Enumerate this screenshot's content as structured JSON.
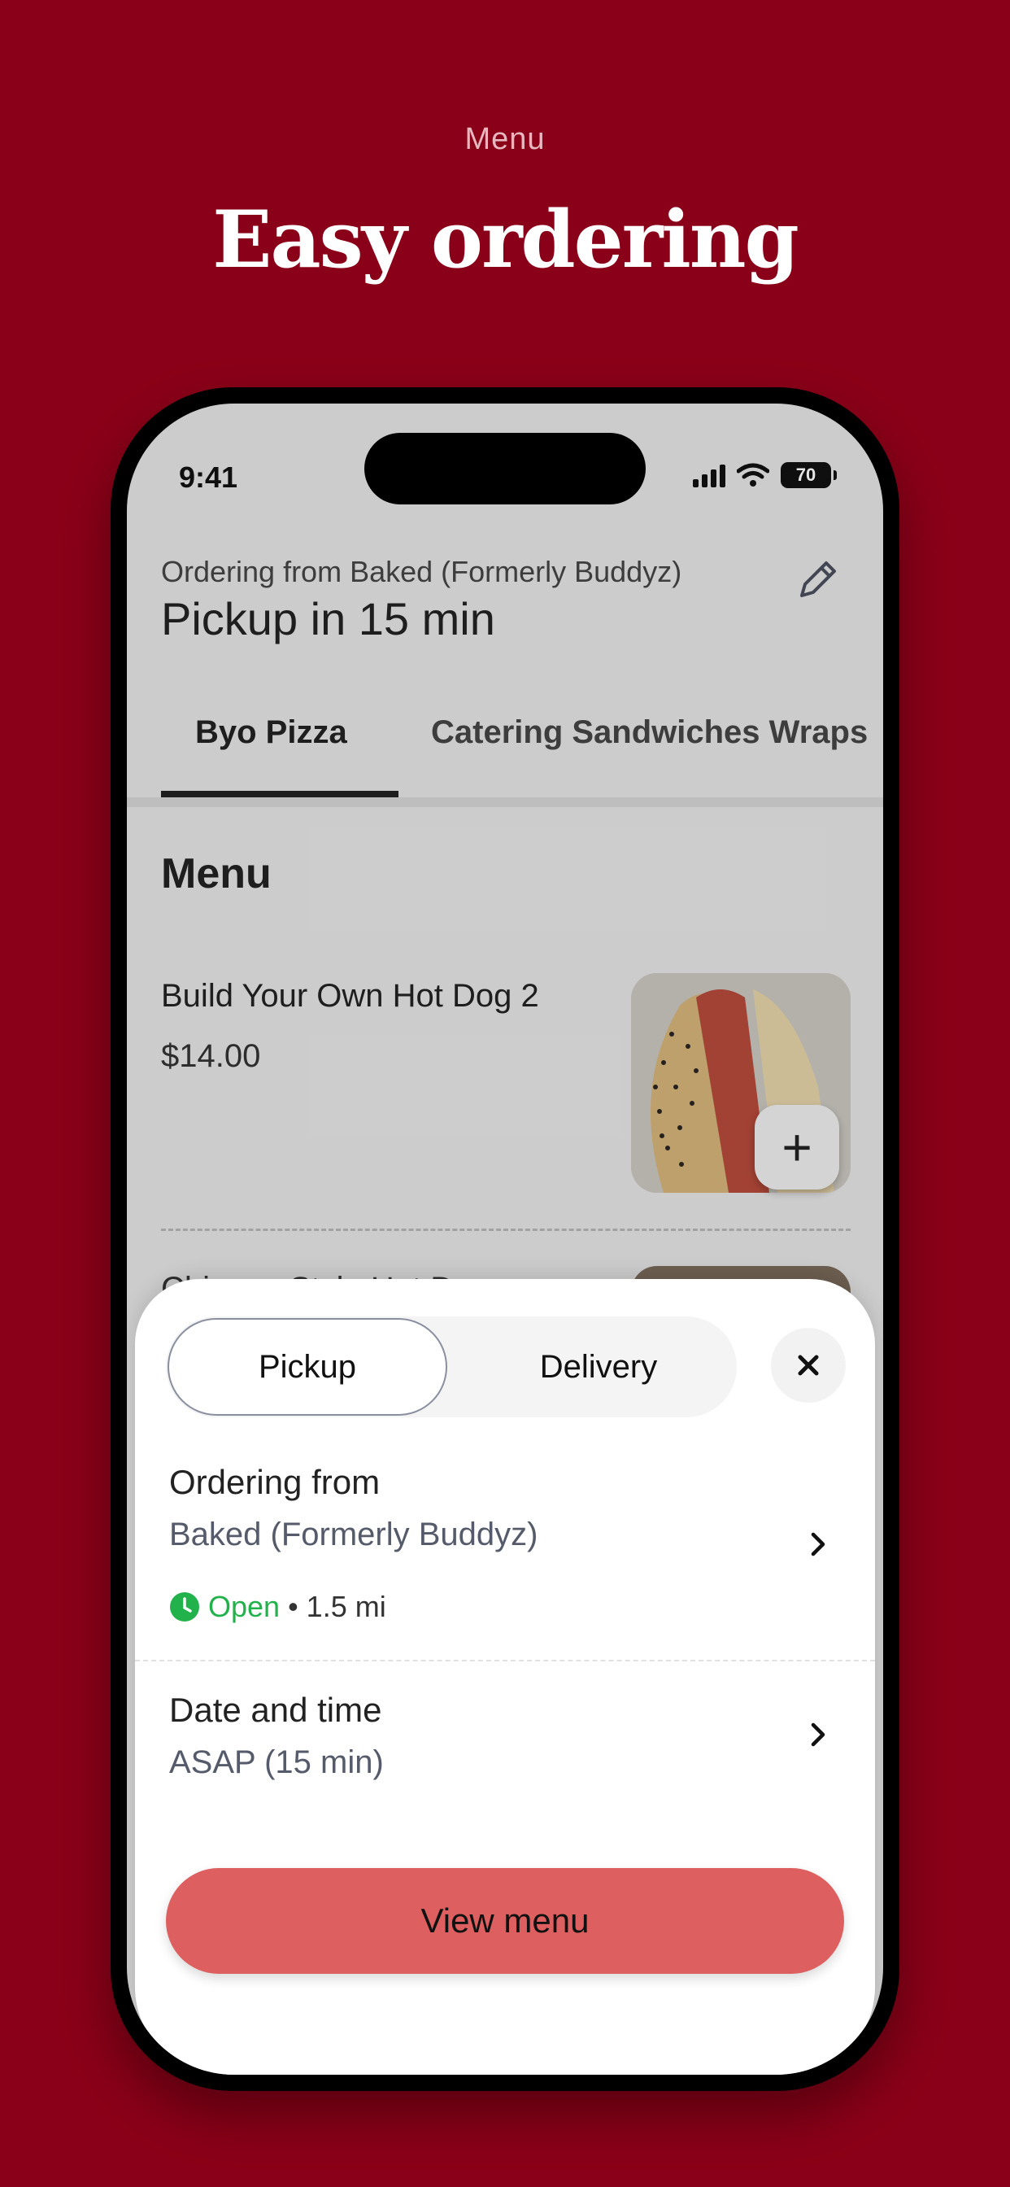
{
  "hero": {
    "eyebrow": "Menu",
    "title": "Easy ordering"
  },
  "status_bar": {
    "time": "9:41",
    "battery": "70"
  },
  "header": {
    "ordering_from_line": "Ordering from Baked (Formerly Buddyz)",
    "pickup_title": "Pickup in 15 min",
    "edit_icon": "pencil-icon"
  },
  "tabs": [
    {
      "label": "Byo Pizza",
      "active": true
    },
    {
      "label": "Catering Sandwiches Wraps",
      "active": false
    }
  ],
  "menu": {
    "heading": "Menu",
    "items": [
      {
        "name": "Build Your Own Hot Dog 2",
        "price": "$14.00"
      },
      {
        "name": "Chicago Style Hot Dog"
      }
    ]
  },
  "sheet": {
    "mode_options": [
      "Pickup",
      "Delivery"
    ],
    "selected_mode": "Pickup",
    "ordering_from": {
      "label": "Ordering from",
      "store": "Baked (Formerly Buddyz)",
      "status": "Open",
      "distance": "• 1.5 mi"
    },
    "date_time": {
      "label": "Date and time",
      "value": "ASAP (15 min)"
    },
    "cta": "View menu"
  },
  "colors": {
    "background": "#8a0018",
    "cta": "#de5f5f",
    "open_status": "#22b24c"
  }
}
